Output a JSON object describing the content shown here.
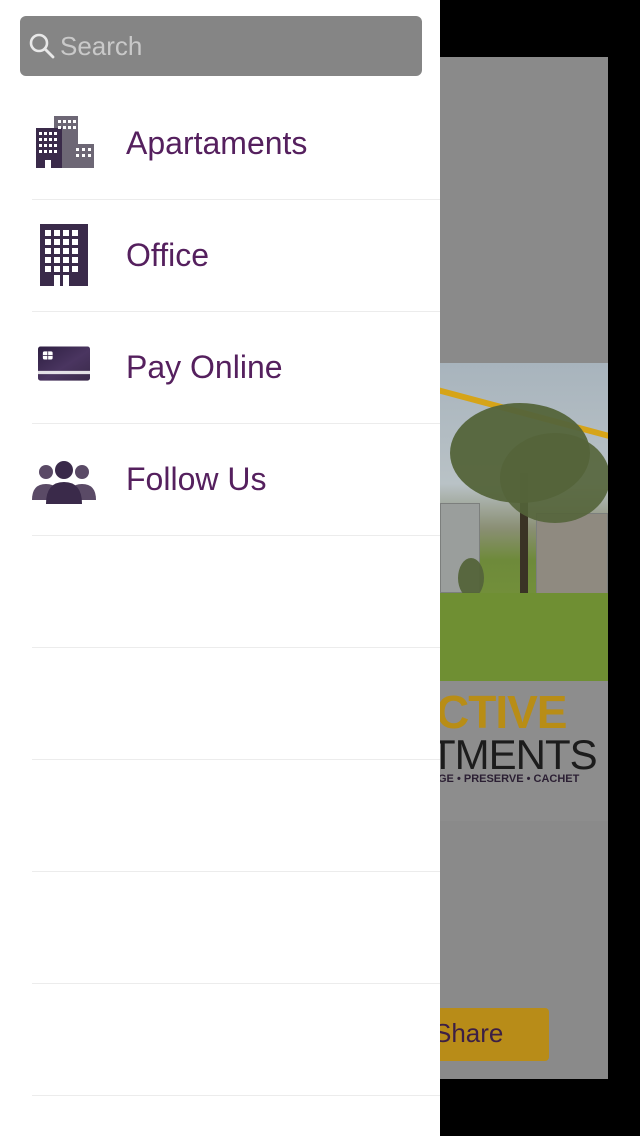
{
  "search": {
    "placeholder": "Search",
    "value": ""
  },
  "menu": {
    "items": [
      {
        "label": "Apartaments",
        "icon": "apartment-buildings-icon"
      },
      {
        "label": "Office",
        "icon": "office-building-icon"
      },
      {
        "label": "Pay Online",
        "icon": "credit-card-icon"
      },
      {
        "label": "Follow Us",
        "icon": "people-group-icon"
      }
    ]
  },
  "background": {
    "logo": {
      "line1": "CTIVE",
      "line2": "TMENTS",
      "tagline": "GE • PRESERVE • CACHET"
    },
    "share_label": "Share"
  },
  "colors": {
    "menu_text": "#55205e",
    "icon_dark": "#3a2a4a",
    "search_bg": "#858585",
    "accent_gold": "#b88c18"
  }
}
